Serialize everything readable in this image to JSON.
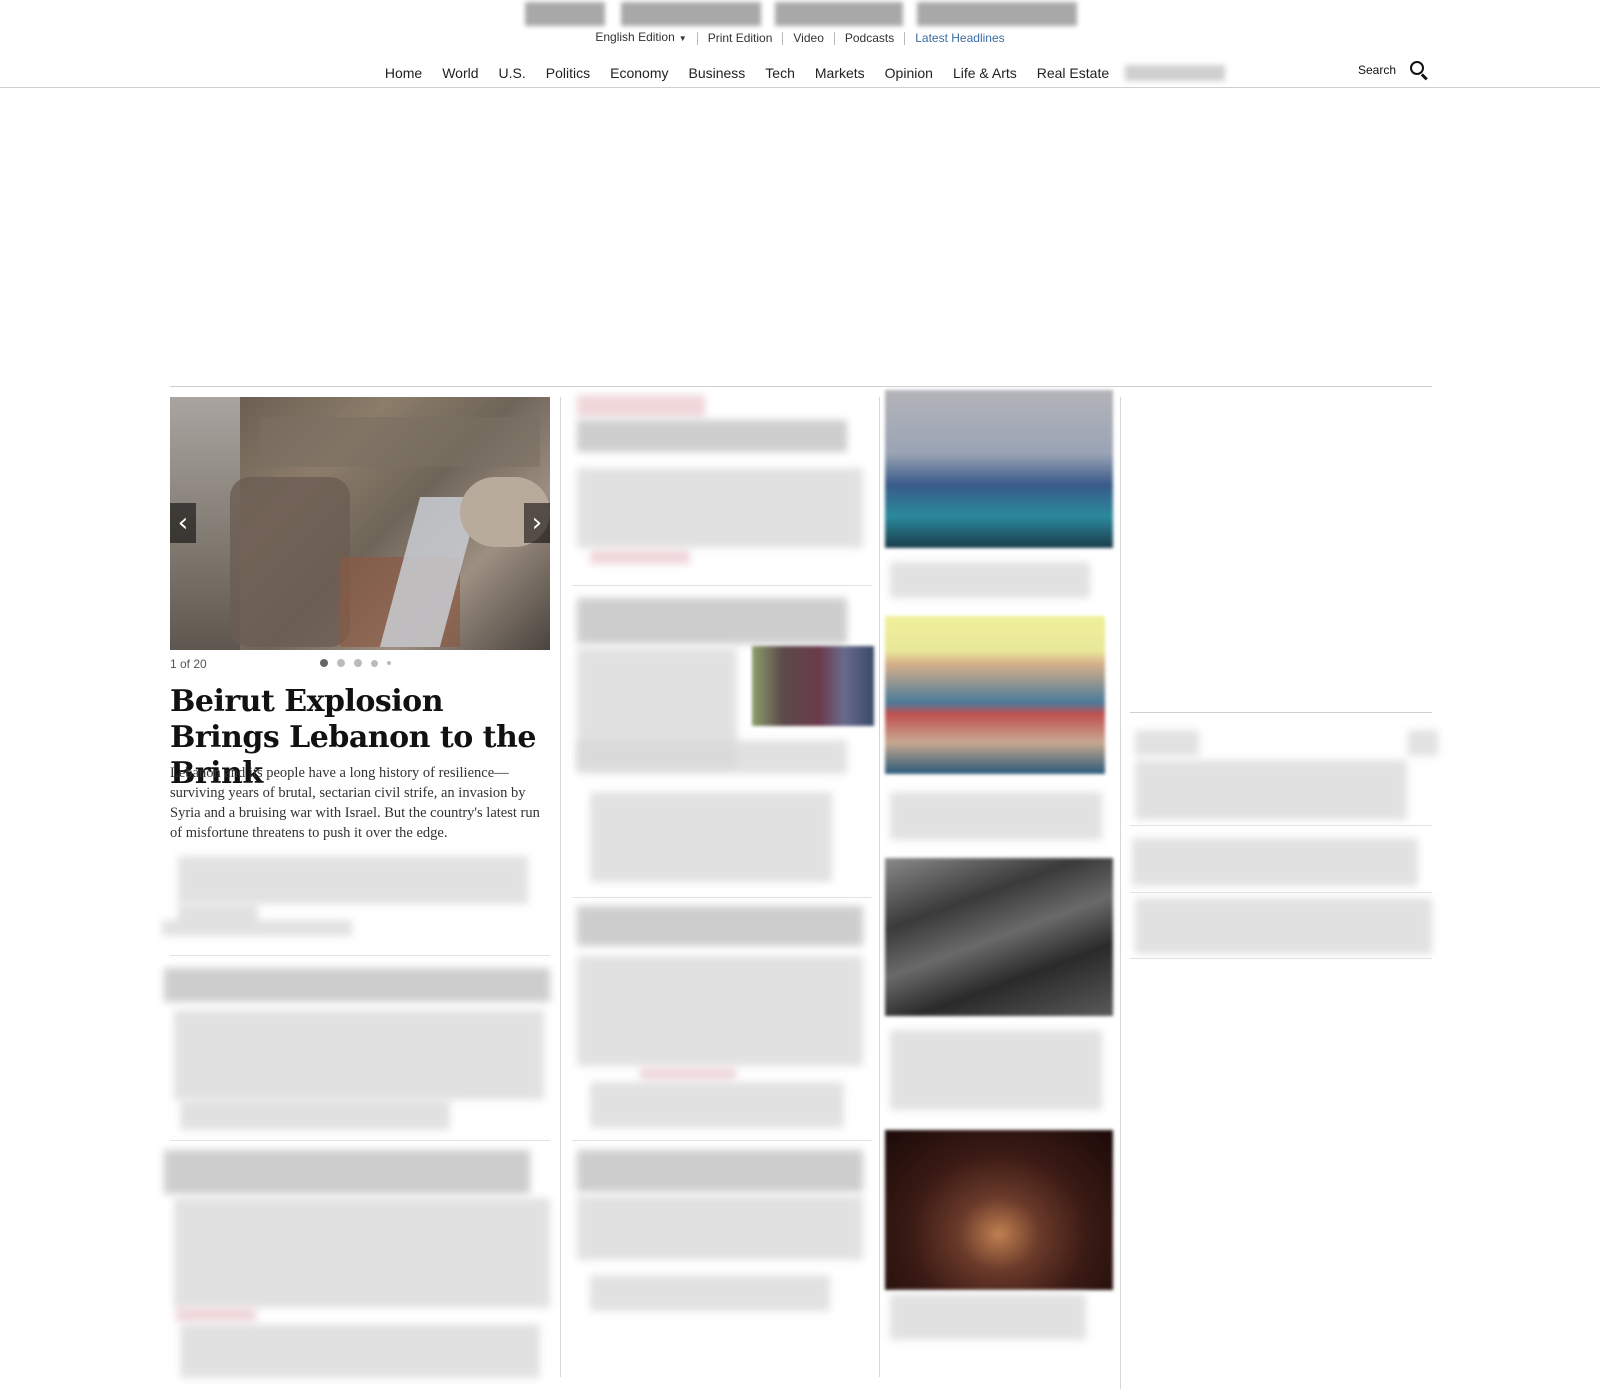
{
  "header": {
    "edition": "English Edition",
    "edition_caret": "▼",
    "links": [
      "Print Edition",
      "Video",
      "Podcasts"
    ],
    "latest": "Latest Headlines",
    "search_label": "Search"
  },
  "nav": {
    "items": [
      "Home",
      "World",
      "U.S.",
      "Politics",
      "Economy",
      "Business",
      "Tech",
      "Markets",
      "Opinion",
      "Life & Arts",
      "Real Estate"
    ]
  },
  "lead": {
    "counter": "1 of 20",
    "prev_arrow": "‹",
    "next_arrow": "›",
    "headline": "Beirut Explosion Brings Lebanon to the Brink",
    "summary": "Lebanon and its people have a long history of resilience—surviving years of brutal, sectarian civil strife, an invasion by Syria and a bruising war with Israel. But the country's latest run of misfortune threatens to push it over the edge."
  },
  "icons": {
    "search": "search-icon",
    "prev": "chevron-left-icon",
    "next": "chevron-right-icon"
  }
}
